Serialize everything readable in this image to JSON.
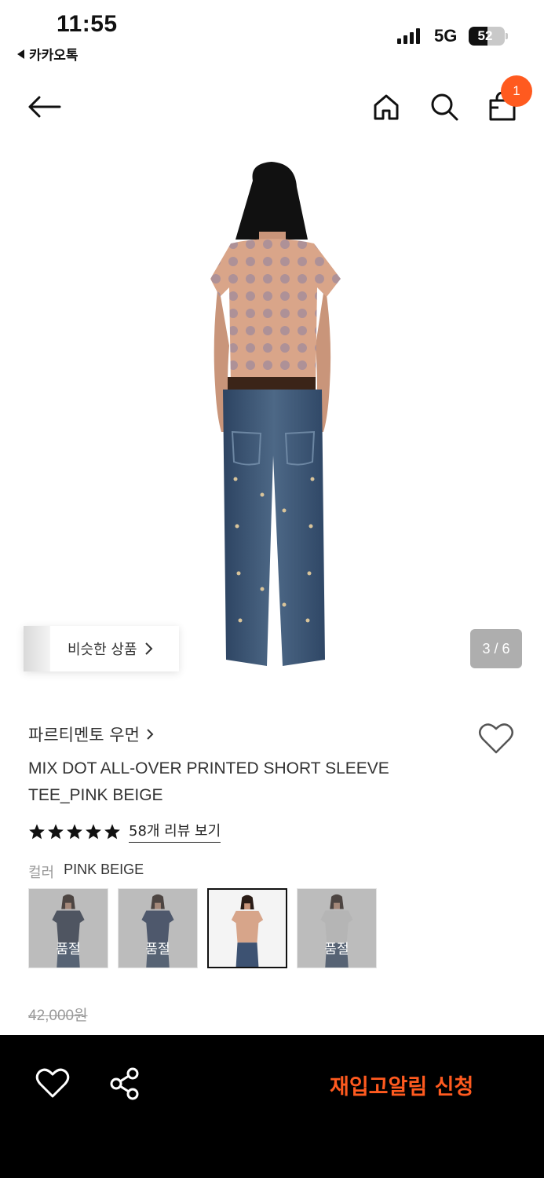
{
  "status_bar": {
    "time": "11:55",
    "back_app": "카카오톡",
    "network": "5G",
    "battery": "52",
    "battery_level": 0.52
  },
  "header": {
    "cart_count": "1",
    "icons": [
      "back-arrow-icon",
      "home-icon",
      "search-icon",
      "shopping-bag-icon"
    ]
  },
  "gallery": {
    "similar_label": "비슷한 상품",
    "counter": "3 / 6"
  },
  "product": {
    "brand": "파르티멘토 우먼",
    "title": "MIX DOT ALL-OVER PRINTED SHORT SLEEVE TEE_PINK BEIGE",
    "rating_stars": 5,
    "review_link": "58개 리뷰 보기",
    "color_label": "컬러",
    "color_value": "PINK BEIGE",
    "swatches": [
      {
        "state": "품절",
        "top_color": "#2f3a4f"
      },
      {
        "state": "품절",
        "top_color": "#2c3f63"
      },
      {
        "state": "",
        "top_color": "#d7a58a"
      },
      {
        "state": "품절",
        "top_color": "#e8e8e8"
      }
    ],
    "original_price": "42,000원"
  },
  "bottom_bar": {
    "cta": "재입고알림 신청",
    "accent": "#ff5a1f"
  }
}
